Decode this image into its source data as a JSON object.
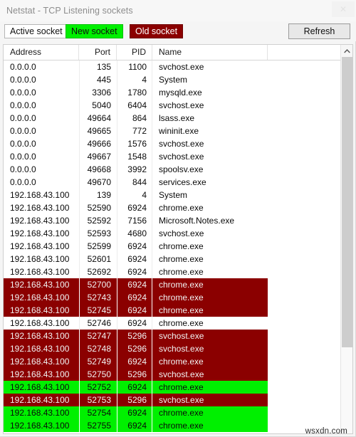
{
  "window": {
    "title": "Netstat - TCP Listening sockets",
    "close_icon": "close-icon",
    "close_glyph": "✕"
  },
  "toolbar": {
    "active_socket_label": "Active socket",
    "new_socket_label": "New socket",
    "old_socket_label": "Old socket",
    "refresh_label": "Refresh",
    "colors": {
      "new_socket": "#00f000",
      "old_socket": "#8b0000",
      "active_socket": "#ffffff"
    }
  },
  "table": {
    "columns": [
      "Address",
      "Port",
      "PID",
      "Name"
    ],
    "rows": [
      {
        "address": "0.0.0.0",
        "port": "135",
        "pid": "1100",
        "name": "svchost.exe",
        "state": "active"
      },
      {
        "address": "0.0.0.0",
        "port": "445",
        "pid": "4",
        "name": "System",
        "state": "active"
      },
      {
        "address": "0.0.0.0",
        "port": "3306",
        "pid": "1780",
        "name": "mysqld.exe",
        "state": "active"
      },
      {
        "address": "0.0.0.0",
        "port": "5040",
        "pid": "6404",
        "name": "svchost.exe",
        "state": "active"
      },
      {
        "address": "0.0.0.0",
        "port": "49664",
        "pid": "864",
        "name": "lsass.exe",
        "state": "active"
      },
      {
        "address": "0.0.0.0",
        "port": "49665",
        "pid": "772",
        "name": "wininit.exe",
        "state": "active"
      },
      {
        "address": "0.0.0.0",
        "port": "49666",
        "pid": "1576",
        "name": "svchost.exe",
        "state": "active"
      },
      {
        "address": "0.0.0.0",
        "port": "49667",
        "pid": "1548",
        "name": "svchost.exe",
        "state": "active"
      },
      {
        "address": "0.0.0.0",
        "port": "49668",
        "pid": "3992",
        "name": "spoolsv.exe",
        "state": "active"
      },
      {
        "address": "0.0.0.0",
        "port": "49670",
        "pid": "844",
        "name": "services.exe",
        "state": "active"
      },
      {
        "address": "192.168.43.100",
        "port": "139",
        "pid": "4",
        "name": "System",
        "state": "active"
      },
      {
        "address": "192.168.43.100",
        "port": "52590",
        "pid": "6924",
        "name": "chrome.exe",
        "state": "active"
      },
      {
        "address": "192.168.43.100",
        "port": "52592",
        "pid": "7156",
        "name": "Microsoft.Notes.exe",
        "state": "active"
      },
      {
        "address": "192.168.43.100",
        "port": "52593",
        "pid": "4680",
        "name": "svchost.exe",
        "state": "active"
      },
      {
        "address": "192.168.43.100",
        "port": "52599",
        "pid": "6924",
        "name": "chrome.exe",
        "state": "active"
      },
      {
        "address": "192.168.43.100",
        "port": "52601",
        "pid": "6924",
        "name": "chrome.exe",
        "state": "active"
      },
      {
        "address": "192.168.43.100",
        "port": "52692",
        "pid": "6924",
        "name": "chrome.exe",
        "state": "active"
      },
      {
        "address": "192.168.43.100",
        "port": "52700",
        "pid": "6924",
        "name": "chrome.exe",
        "state": "old"
      },
      {
        "address": "192.168.43.100",
        "port": "52743",
        "pid": "6924",
        "name": "chrome.exe",
        "state": "old"
      },
      {
        "address": "192.168.43.100",
        "port": "52745",
        "pid": "6924",
        "name": "chrome.exe",
        "state": "old"
      },
      {
        "address": "192.168.43.100",
        "port": "52746",
        "pid": "6924",
        "name": "chrome.exe",
        "state": "active"
      },
      {
        "address": "192.168.43.100",
        "port": "52747",
        "pid": "5296",
        "name": "svchost.exe",
        "state": "old"
      },
      {
        "address": "192.168.43.100",
        "port": "52748",
        "pid": "5296",
        "name": "svchost.exe",
        "state": "old"
      },
      {
        "address": "192.168.43.100",
        "port": "52749",
        "pid": "6924",
        "name": "chrome.exe",
        "state": "old"
      },
      {
        "address": "192.168.43.100",
        "port": "52750",
        "pid": "5296",
        "name": "svchost.exe",
        "state": "old"
      },
      {
        "address": "192.168.43.100",
        "port": "52752",
        "pid": "6924",
        "name": "chrome.exe",
        "state": "new"
      },
      {
        "address": "192.168.43.100",
        "port": "52753",
        "pid": "5296",
        "name": "svchost.exe",
        "state": "old"
      },
      {
        "address": "192.168.43.100",
        "port": "52754",
        "pid": "6924",
        "name": "chrome.exe",
        "state": "new"
      },
      {
        "address": "192.168.43.100",
        "port": "52755",
        "pid": "6924",
        "name": "chrome.exe",
        "state": "new"
      }
    ]
  },
  "scrollbar": {
    "up_icon": "chevron-up-icon"
  },
  "watermark": {
    "text": "wsxdn.com"
  }
}
